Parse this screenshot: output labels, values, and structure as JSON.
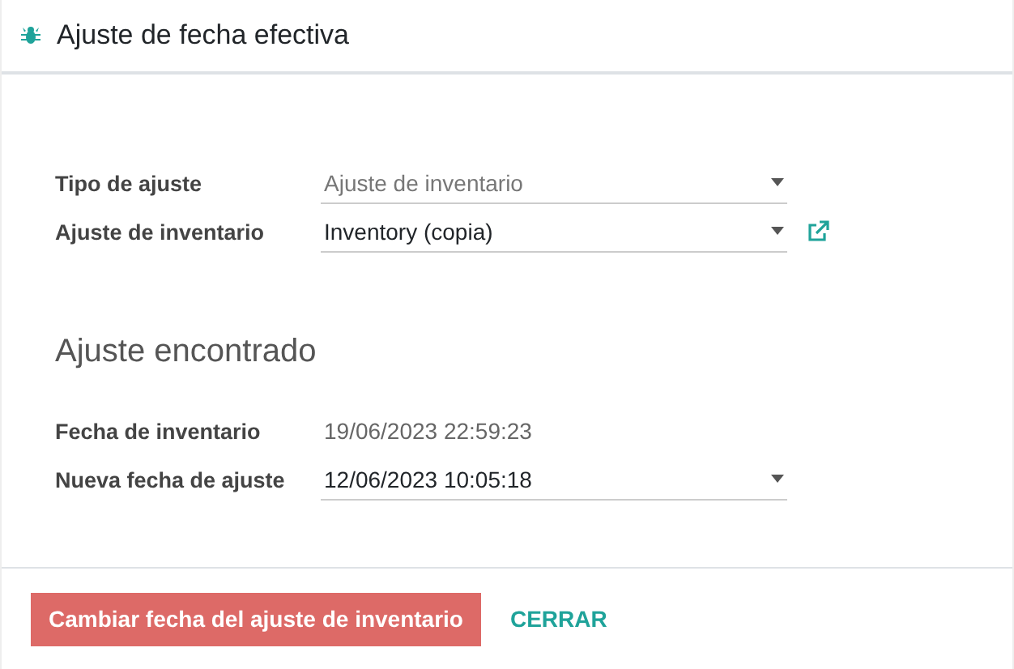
{
  "dialog": {
    "title": "Ajuste de fecha efectiva"
  },
  "fields": [
    {
      "label": "Tipo de ajuste",
      "kind": "select",
      "value": "Ajuste de inventario",
      "disabled": true,
      "has_link": false
    },
    {
      "label": "Ajuste de inventario",
      "kind": "select",
      "value": "Inventory (copia)",
      "disabled": false,
      "has_link": true
    }
  ],
  "section": {
    "title": "Ajuste encontrado",
    "fields": [
      {
        "label": "Fecha de inventario",
        "kind": "readonly",
        "value": "19/06/2023 22:59:23"
      },
      {
        "label": "Nueva fecha de ajuste",
        "kind": "select",
        "value": "12/06/2023 10:05:18",
        "disabled": false,
        "has_link": false
      }
    ]
  },
  "buttons": [
    {
      "label": "Cambiar fecha del ajuste de inventario",
      "kind": "primary"
    },
    {
      "label": "CERRAR",
      "kind": "link"
    }
  ]
}
